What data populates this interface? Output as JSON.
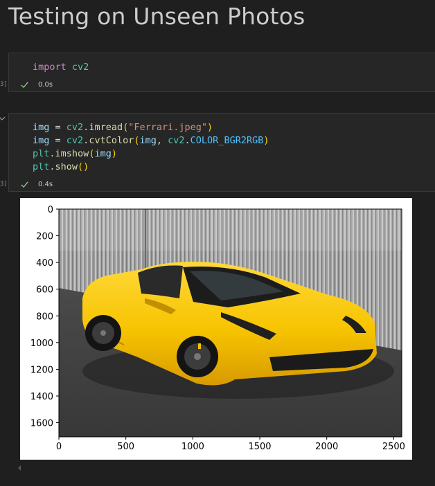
{
  "heading": "Testing on Unseen Photos",
  "cells": [
    {
      "exec_count": "3]",
      "time": "0.0s",
      "code": {
        "l1_kw": "import",
        "l1_mod": "cv2"
      }
    },
    {
      "exec_count": "3]",
      "time": "0.4s",
      "code": {
        "l1_var": "img",
        "l1_eq": " = ",
        "l1_mod": "cv2",
        "l1_dot": ".",
        "l1_fn": "imread",
        "l1_p1": "(",
        "l1_str": "\"Ferrari.jpeg\"",
        "l1_p2": ")",
        "l2_var": "img",
        "l2_eq": " = ",
        "l2_mod": "cv2",
        "l2_dot": ".",
        "l2_fn": "cvtColor",
        "l2_p1": "(",
        "l2_arg1": "img",
        "l2_comma": ", ",
        "l2_mod2": "cv2",
        "l2_dot2": ".",
        "l2_const": "COLOR_BGR2RGB",
        "l2_p2": ")",
        "l3_var": "plt",
        "l3_dot": ".",
        "l3_fn": "imshow",
        "l3_p1": "(",
        "l3_arg": "img",
        "l3_p2": ")",
        "l4_var": "plt",
        "l4_dot": ".",
        "l4_fn": "show",
        "l4_p": "()"
      }
    }
  ],
  "chart_data": {
    "type": "image",
    "title": "",
    "xlabel": "",
    "ylabel": "",
    "xlim": [
      0,
      2560
    ],
    "ylim": [
      1706,
      0
    ],
    "x_ticks": [
      0,
      500,
      1000,
      1500,
      2000,
      2500
    ],
    "y_ticks": [
      0,
      200,
      400,
      600,
      800,
      1000,
      1200,
      1400,
      1600
    ],
    "image_subject": "yellow sports car in front of a grey textured wall"
  },
  "colors": {
    "background": "#1f1f1f",
    "cell_background": "#262626",
    "check": "#89d185",
    "car_yellow": "#f7c800"
  }
}
